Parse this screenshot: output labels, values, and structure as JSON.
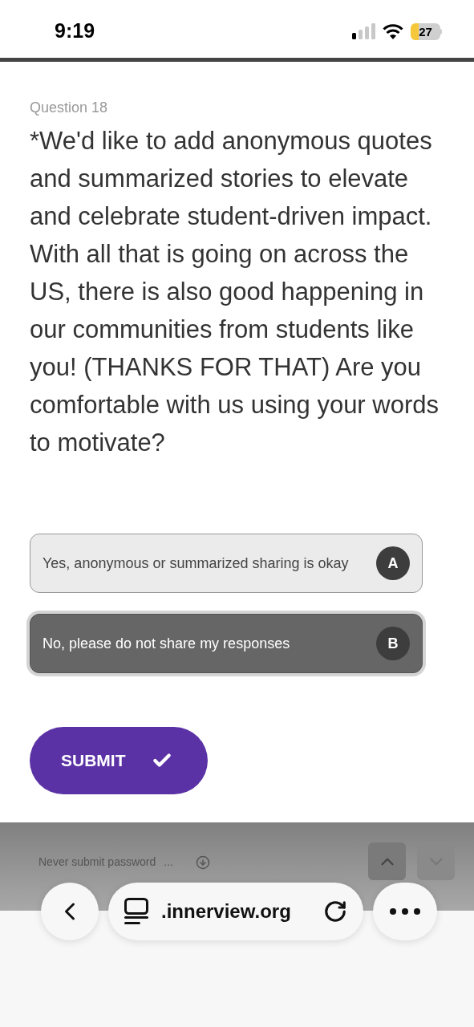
{
  "status_bar": {
    "time": "9:19",
    "battery": "27"
  },
  "question": {
    "label": "Question 18",
    "text": "*We'd like to add anonymous quotes and summarized stories to elevate and celebrate student-driven impact. With all that is going on across the US, there is also good happening in our communities from students like you! (THANKS FOR THAT) Are you comfortable with us using your words to motivate?"
  },
  "options": [
    {
      "text": "Yes, anonymous or summarized sharing is okay",
      "key": "A",
      "selected": false
    },
    {
      "text": "No, please do not share my responses",
      "key": "B",
      "selected": true
    }
  ],
  "submit": {
    "label": "SUBMIT"
  },
  "password_bar": {
    "text": "Never submit password",
    "more": "..."
  },
  "browser": {
    "url": ".innerview.org"
  }
}
